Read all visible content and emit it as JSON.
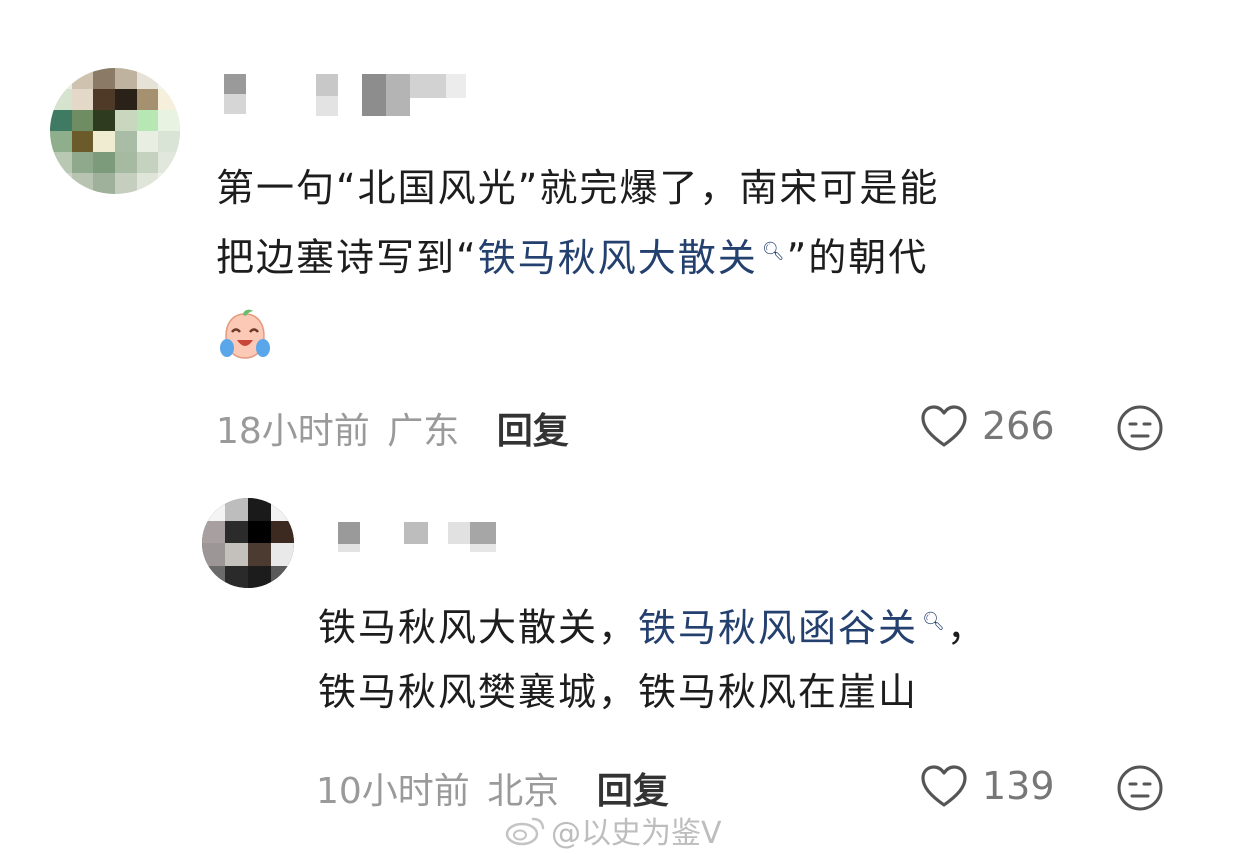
{
  "comment": {
    "text_line1": "第一句“北国风光”就完爆了，南宋可是能",
    "text_line2_pre": "把边塞诗写到“",
    "text_line2_link": "铁马秋风大散关",
    "text_line2_post": "”的朝代",
    "time": "18小时前",
    "location": "广东",
    "reply_label": "回复",
    "likes": "266"
  },
  "reply": {
    "text_pre": "铁马秋风大散关，",
    "text_link": "铁马秋风函谷关",
    "text_post": "，",
    "text_line2": "铁马秋风樊襄城，铁马秋风在崖山",
    "time": "10小时前",
    "location": "北京",
    "reply_label": "回复",
    "likes": "139"
  },
  "watermark": "@以史为鉴V",
  "icons": {
    "like": "heart-outline-icon",
    "dislike": "neutral-face-icon",
    "search_hint": "search-icon",
    "emoji": "crying-laughing-emoji",
    "watermark_logo": "weibo-logo-icon"
  },
  "colors": {
    "link": "#24406e",
    "meta": "#9a9a9a"
  }
}
